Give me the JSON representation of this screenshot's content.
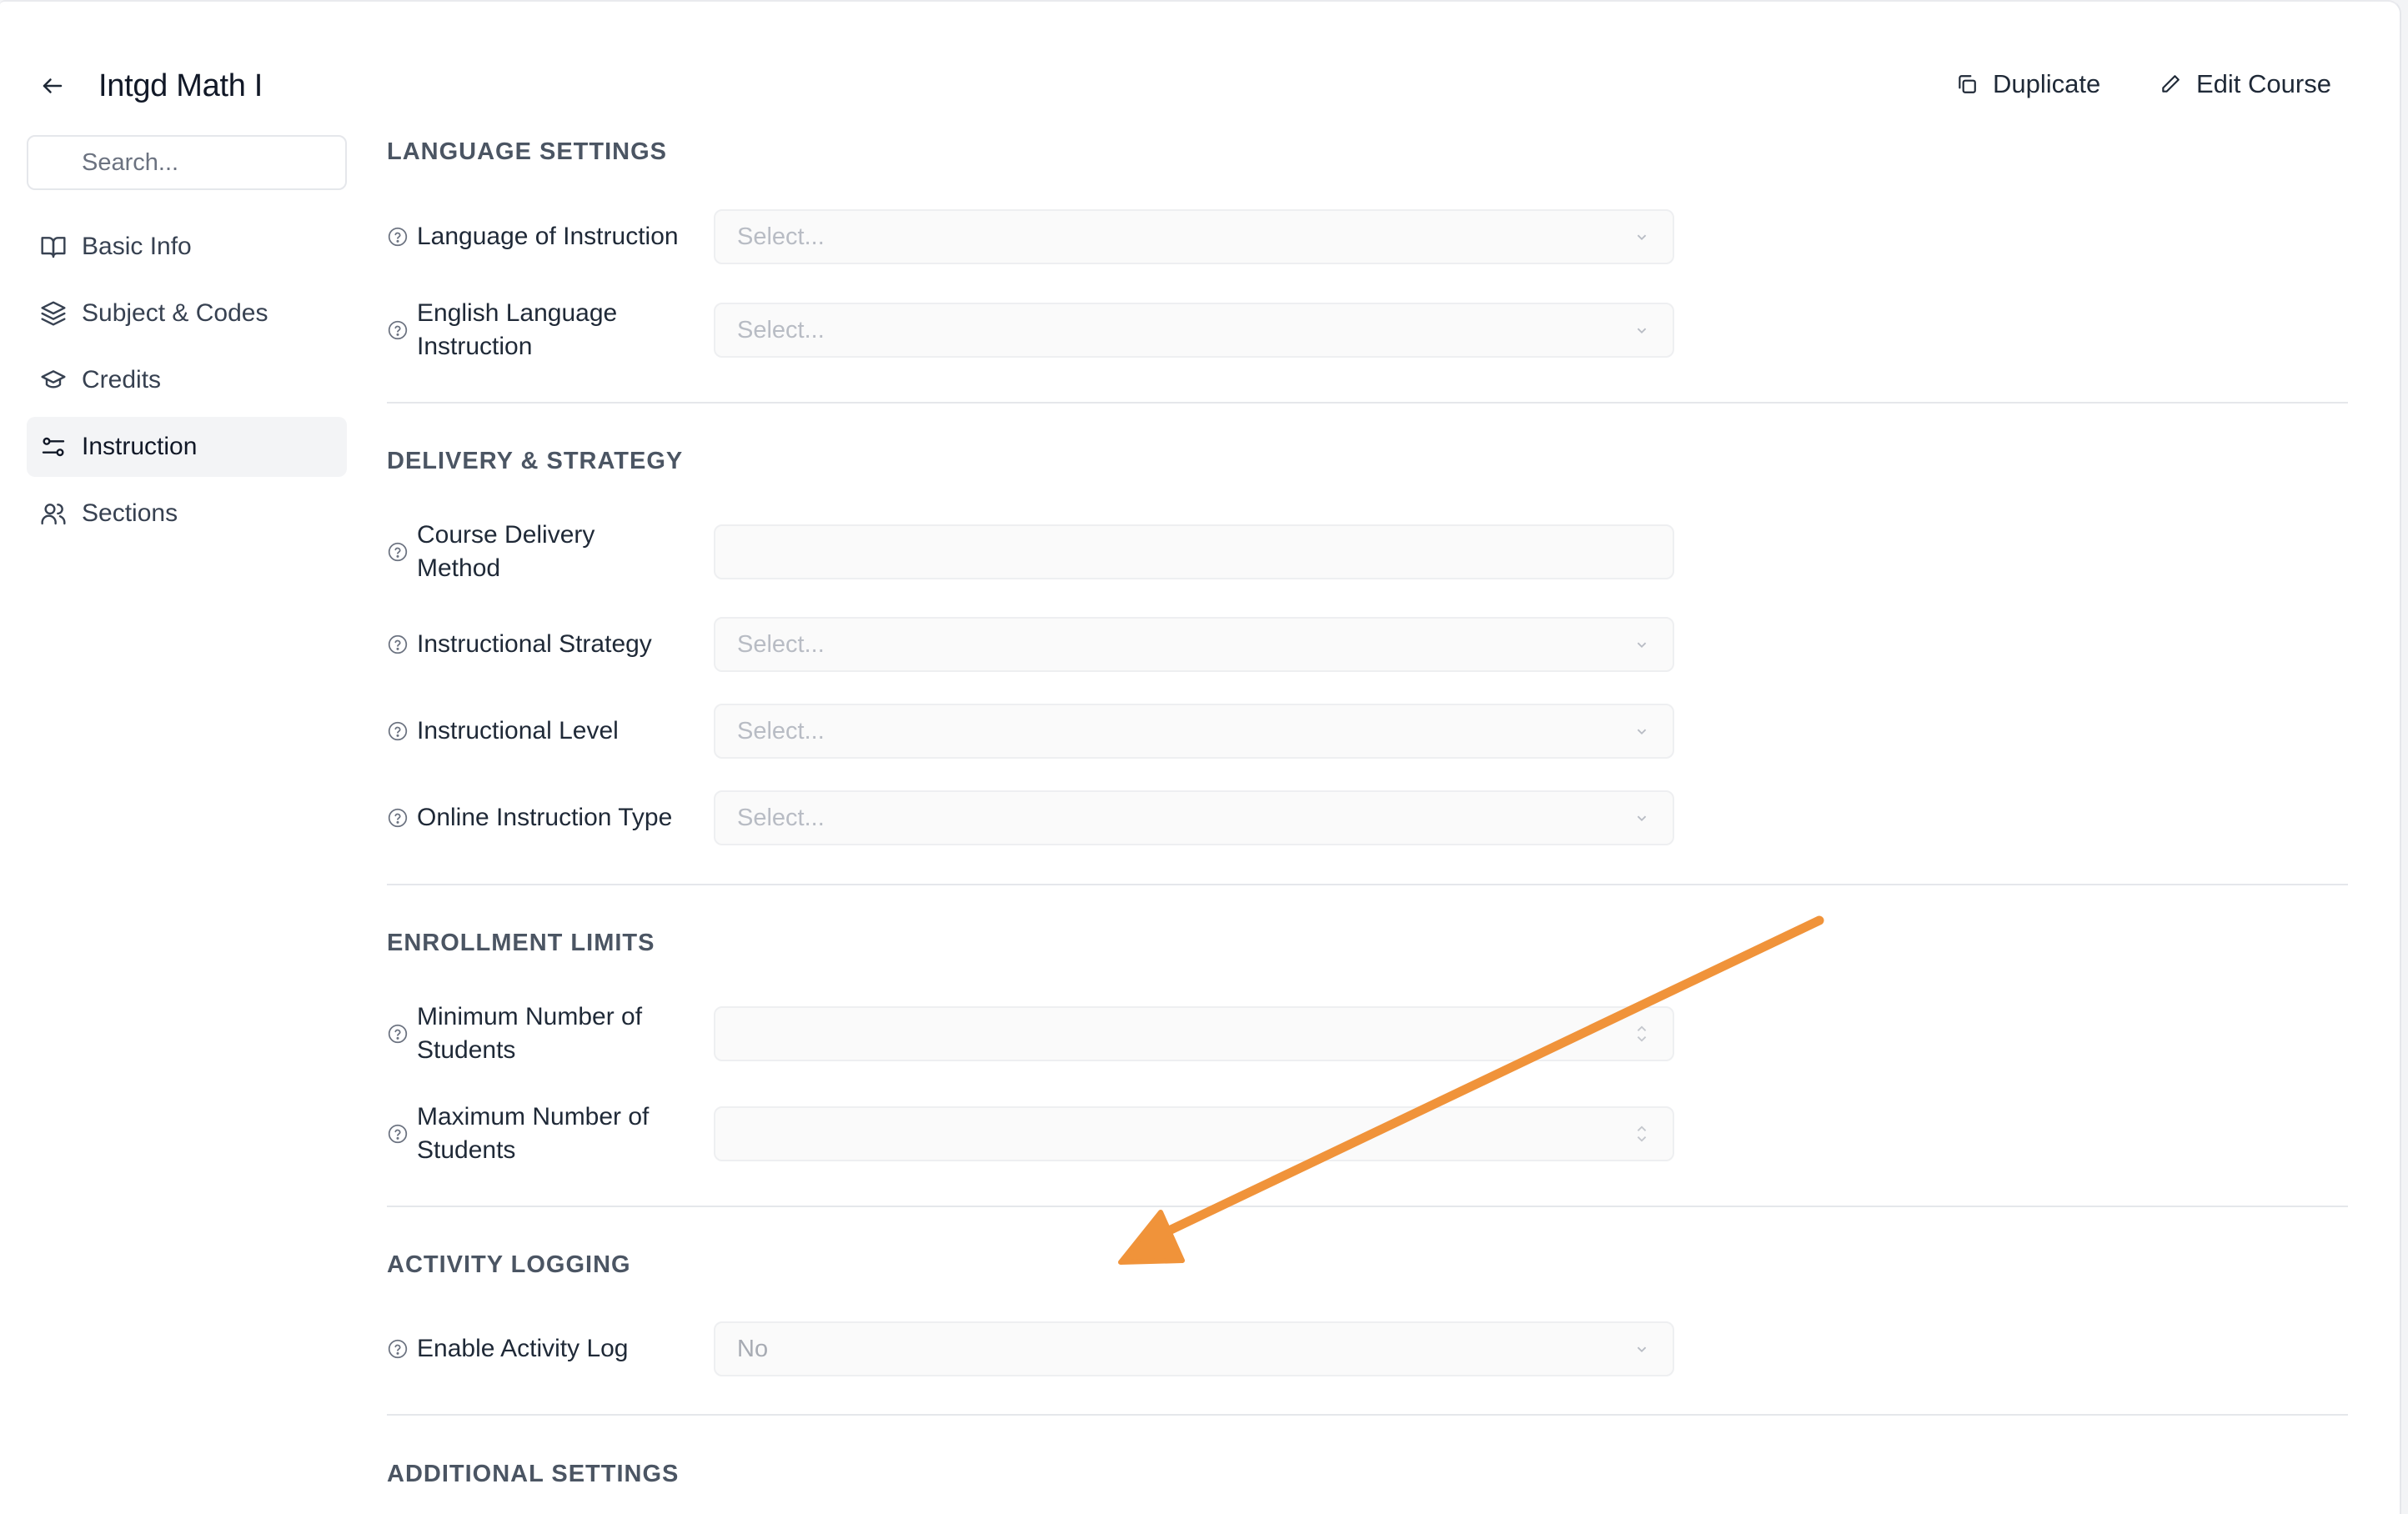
{
  "header": {
    "title": "Intgd Math I",
    "duplicate_label": "Duplicate",
    "edit_label": "Edit Course"
  },
  "sidebar": {
    "search_placeholder": "Search...",
    "items": [
      {
        "label": "Basic Info",
        "icon": "book-open-icon"
      },
      {
        "label": "Subject & Codes",
        "icon": "layers-icon"
      },
      {
        "label": "Credits",
        "icon": "graduation-cap-icon"
      },
      {
        "label": "Instruction",
        "icon": "sliders-icon",
        "active": true
      },
      {
        "label": "Sections",
        "icon": "users-icon"
      }
    ]
  },
  "sections": {
    "language": {
      "title": "LANGUAGE SETTINGS",
      "fields": [
        {
          "label": "Language of Instruction",
          "placeholder": "Select..."
        },
        {
          "label": "English Language Instruction",
          "placeholder": "Select..."
        }
      ]
    },
    "delivery": {
      "title": "DELIVERY & STRATEGY",
      "fields": [
        {
          "label": "Course Delivery Method",
          "placeholder": ""
        },
        {
          "label": "Instructional Strategy",
          "placeholder": "Select..."
        },
        {
          "label": "Instructional Level",
          "placeholder": "Select..."
        },
        {
          "label": "Online Instruction Type",
          "placeholder": "Select..."
        }
      ]
    },
    "enrollment": {
      "title": "ENROLLMENT LIMITS",
      "fields": [
        {
          "label": "Minimum Number of Students",
          "value": ""
        },
        {
          "label": "Maximum Number of Students",
          "value": ""
        }
      ]
    },
    "activity": {
      "title": "ACTIVITY LOGGING",
      "fields": [
        {
          "label": "Enable Activity Log",
          "value": "No"
        }
      ]
    },
    "additional": {
      "title": "ADDITIONAL SETTINGS"
    }
  },
  "colors": {
    "annotation_arrow": "#f0933a",
    "divider": "#e5e7eb",
    "active_nav_bg": "#f3f4f6"
  }
}
